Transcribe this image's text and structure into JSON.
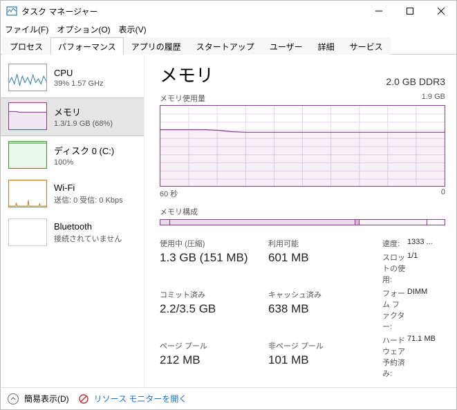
{
  "window": {
    "title": "タスク マネージャー"
  },
  "menubar": {
    "file": "ファイル(F)",
    "options": "オプション(O)",
    "view": "表示(V)"
  },
  "tabs": {
    "processes": "プロセス",
    "performance": "パフォーマンス",
    "app_history": "アプリの履歴",
    "startup": "スタートアップ",
    "users": "ユーザー",
    "details": "詳細",
    "services": "サービス"
  },
  "sidebar": {
    "cpu": {
      "title": "CPU",
      "sub": "39%  1.57 GHz"
    },
    "memory": {
      "title": "メモリ",
      "sub": "1.3/1.9 GB (68%)"
    },
    "disk": {
      "title": "ディスク 0 (C:)",
      "sub": "100%"
    },
    "wifi": {
      "title": "Wi-Fi",
      "sub": "送信: 0  受信:  0 Kbps"
    },
    "bluetooth": {
      "title": "Bluetooth",
      "sub": "接続されていません"
    }
  },
  "main": {
    "title": "メモリ",
    "capacity": "2.0 GB DDR3",
    "usage_label": "メモリ使用量",
    "usage_max": "1.9 GB",
    "xaxis_left": "60 秒",
    "xaxis_right": "0",
    "composition_label": "メモリ構成"
  },
  "stats": {
    "in_use_label": "使用中 (圧縮)",
    "in_use_value": "1.3 GB (151 MB)",
    "available_label": "利用可能",
    "available_value": "601 MB",
    "committed_label": "コミット済み",
    "committed_value": "2.2/3.5 GB",
    "cached_label": "キャッシュ済み",
    "cached_value": "638 MB",
    "paged_label": "ページ プール",
    "paged_value": "212 MB",
    "nonpaged_label": "非ページ プール",
    "nonpaged_value": "101 MB"
  },
  "specs": {
    "speed_label": "速度:",
    "speed_value": "1333 ...",
    "slots_label": "スロットの使用:",
    "slots_value": "1/1",
    "form_label": "フォーム ファクター:",
    "form_value": "DIMM",
    "hw_reserved_label": "ハードウェア予約済み:",
    "hw_reserved_value": "71.1 MB"
  },
  "footer": {
    "fewer": "簡易表示(D)",
    "resmon": "リソース モニターを開く"
  },
  "chart_data": {
    "type": "line",
    "title": "メモリ使用量",
    "ylabel": "",
    "xlabel": "",
    "ylim": [
      0,
      1.9
    ],
    "x_range_seconds": [
      60,
      0
    ],
    "series": [
      {
        "name": "使用中 (GB)",
        "values": [
          1.34,
          1.34,
          1.35,
          1.34,
          1.33,
          1.31,
          1.3,
          1.3,
          1.3,
          1.3,
          1.3,
          1.3,
          1.3,
          1.3,
          1.3,
          1.3,
          1.3,
          1.3,
          1.3,
          1.3
        ]
      }
    ],
    "composition": {
      "total_gb": 1.9,
      "segments": [
        {
          "name": "hardware_reserved",
          "gb": 0.07
        },
        {
          "name": "in_use",
          "gb": 1.3
        },
        {
          "name": "modified",
          "gb": 0.02
        },
        {
          "name": "standby_cached",
          "gb": 0.46
        },
        {
          "name": "free",
          "gb": 0.05
        }
      ]
    }
  }
}
